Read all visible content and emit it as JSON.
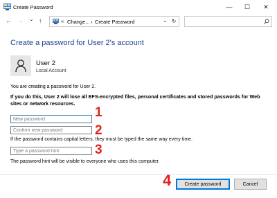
{
  "window": {
    "title": "Create Password",
    "minimize_glyph": "—",
    "maximize_glyph": "☐",
    "close_glyph": "✕"
  },
  "nav": {
    "back_glyph": "←",
    "forward_glyph": "→",
    "recent_glyph": "⌄",
    "up_glyph": "↑",
    "breadcrumb": [
      "Change...",
      "Create Password"
    ],
    "separator_glyph": "›",
    "chevron_glyph": "«",
    "dropdown_glyph": "⌄",
    "refresh_glyph": "↻",
    "search_placeholder": ""
  },
  "content": {
    "heading": "Create a password for User 2's account",
    "user_name": "User 2",
    "user_type": "Local Account",
    "creating_text": "You are creating a password for User 2.",
    "warning_text": "If you do this, User 2 will lose all EFS-encrypted files, personal certificates and stored passwords for Web sites or network resources.",
    "new_password_placeholder": "New password",
    "confirm_password_placeholder": "Confirm new password",
    "capital_letters_note": "If the password contains capital letters, they must be typed the same way every time.",
    "hint_placeholder": "Type a password hint",
    "hint_visibility_note": "The password hint will be visible to everyone who uses this computer."
  },
  "annotations": [
    "1",
    "2",
    "3",
    "4"
  ],
  "buttons": {
    "create": "Create password",
    "cancel": "Cancel"
  },
  "colors": {
    "heading": "#1e3f8f",
    "annotation": "#e0211d",
    "focus_border": "#0078d7"
  }
}
